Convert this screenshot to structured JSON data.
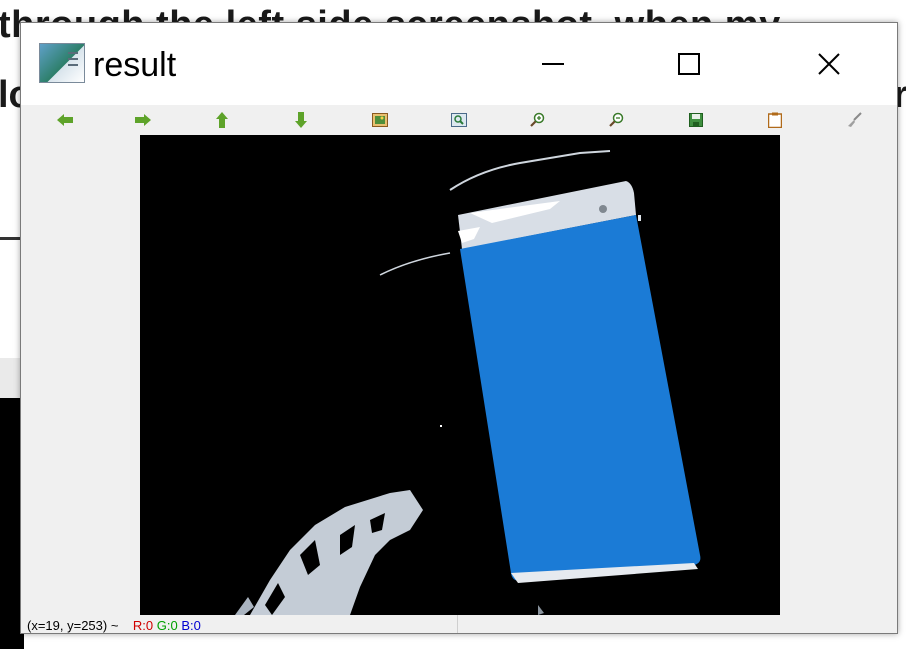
{
  "background_page": {
    "line1": "through the left side screenshot, when my",
    "line2_left": "lo",
    "line2_right": "r"
  },
  "window": {
    "title": "result",
    "app_icon": "app-window-icon",
    "controls": {
      "minimize": "minimize-icon",
      "maximize": "maximize-icon",
      "close": "close-icon"
    }
  },
  "toolbar": {
    "tools": [
      {
        "name": "pan-left",
        "icon": "arrow-left-icon"
      },
      {
        "name": "pan-right",
        "icon": "arrow-right-icon"
      },
      {
        "name": "pan-up",
        "icon": "arrow-up-icon"
      },
      {
        "name": "pan-down",
        "icon": "arrow-down-icon"
      },
      {
        "name": "zoom-fit",
        "icon": "image-icon"
      },
      {
        "name": "zoom-region",
        "icon": "zoom-region-icon"
      },
      {
        "name": "zoom-in",
        "icon": "zoom-in-icon"
      },
      {
        "name": "zoom-out",
        "icon": "zoom-out-icon"
      },
      {
        "name": "save",
        "icon": "save-icon"
      },
      {
        "name": "copy",
        "icon": "clipboard-icon"
      },
      {
        "name": "properties",
        "icon": "brush-icon"
      }
    ]
  },
  "image": {
    "description_colors": {
      "background": "#000000",
      "phone_screen": "#1b7bd6",
      "phone_frame": "#c8d0dc"
    }
  },
  "statusbar": {
    "coords": "(x=19, y=253) ~",
    "r": "R:0",
    "g": "G:0",
    "b": "B:0"
  }
}
